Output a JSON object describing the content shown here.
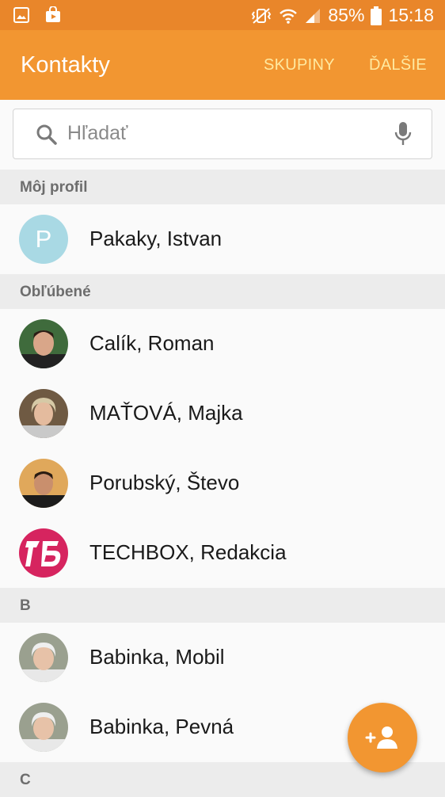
{
  "status_bar": {
    "battery": "85%",
    "time": "15:18"
  },
  "app_bar": {
    "title": "Kontakty",
    "groups_label": "SKUPINY",
    "more_label": "ĎALŠIE"
  },
  "search": {
    "placeholder": "Hľadať"
  },
  "sections": {
    "profile": "Môj profil",
    "favorites": "Obľúbené",
    "b": "B",
    "c": "C"
  },
  "profile": {
    "name": "Pakaky, Istvan",
    "initial": "P"
  },
  "favorites": [
    {
      "name": "Calík, Roman"
    },
    {
      "name": "MAŤOVÁ, Majka"
    },
    {
      "name": "Porubský, Števo"
    },
    {
      "name": "TECHBOX, Redakcia"
    }
  ],
  "b_contacts": [
    {
      "name": "Babinka, Mobil"
    },
    {
      "name": "Babinka, Pevná"
    }
  ],
  "colors": {
    "accent": "#f29631",
    "status": "#e9862a",
    "action_text": "#ffe9a0",
    "profile_avatar": "#a9d9e4",
    "techbox": "#d6245f"
  }
}
